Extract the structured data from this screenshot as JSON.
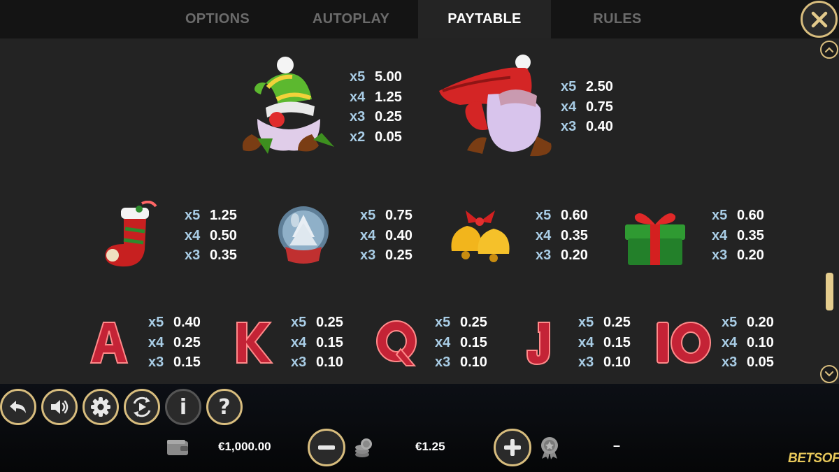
{
  "tabs": [
    {
      "label": "OPTIONS",
      "active": false
    },
    {
      "label": "AUTOPLAY",
      "active": false
    },
    {
      "label": "PAYTABLE",
      "active": true
    },
    {
      "label": "RULES",
      "active": false
    }
  ],
  "colors": {
    "accent_gold": "#d8bd7e",
    "multiplier_blue": "#a9cde6",
    "panel_bg": "#232323",
    "tab_bar_bg": "#141414"
  },
  "paytable": {
    "green_gnome": {
      "icon": "green-hat-gnome-icon",
      "pays": [
        {
          "mult": "x5",
          "value": "5.00"
        },
        {
          "mult": "x4",
          "value": "1.25"
        },
        {
          "mult": "x3",
          "value": "0.25"
        },
        {
          "mult": "x2",
          "value": "0.05"
        }
      ]
    },
    "red_gnome": {
      "icon": "red-hat-gnome-icon",
      "pays": [
        {
          "mult": "x5",
          "value": "2.50"
        },
        {
          "mult": "x4",
          "value": "0.75"
        },
        {
          "mult": "x3",
          "value": "0.40"
        }
      ]
    },
    "stocking": {
      "icon": "christmas-stocking-icon",
      "pays": [
        {
          "mult": "x5",
          "value": "1.25"
        },
        {
          "mult": "x4",
          "value": "0.50"
        },
        {
          "mult": "x3",
          "value": "0.35"
        }
      ]
    },
    "snow_globe": {
      "icon": "snow-globe-icon",
      "pays": [
        {
          "mult": "x5",
          "value": "0.75"
        },
        {
          "mult": "x4",
          "value": "0.40"
        },
        {
          "mult": "x3",
          "value": "0.25"
        }
      ]
    },
    "bells": {
      "icon": "bells-icon",
      "pays": [
        {
          "mult": "x5",
          "value": "0.60"
        },
        {
          "mult": "x4",
          "value": "0.35"
        },
        {
          "mult": "x3",
          "value": "0.20"
        }
      ]
    },
    "gift": {
      "icon": "gift-box-icon",
      "pays": [
        {
          "mult": "x5",
          "value": "0.60"
        },
        {
          "mult": "x4",
          "value": "0.35"
        },
        {
          "mult": "x3",
          "value": "0.20"
        }
      ]
    },
    "a": {
      "letter": "A",
      "pays": [
        {
          "mult": "x5",
          "value": "0.40"
        },
        {
          "mult": "x4",
          "value": "0.25"
        },
        {
          "mult": "x3",
          "value": "0.15"
        }
      ]
    },
    "k": {
      "letter": "K",
      "pays": [
        {
          "mult": "x5",
          "value": "0.25"
        },
        {
          "mult": "x4",
          "value": "0.15"
        },
        {
          "mult": "x3",
          "value": "0.10"
        }
      ]
    },
    "q": {
      "letter": "Q",
      "pays": [
        {
          "mult": "x5",
          "value": "0.25"
        },
        {
          "mult": "x4",
          "value": "0.15"
        },
        {
          "mult": "x3",
          "value": "0.10"
        }
      ]
    },
    "j": {
      "letter": "J",
      "pays": [
        {
          "mult": "x5",
          "value": "0.25"
        },
        {
          "mult": "x4",
          "value": "0.15"
        },
        {
          "mult": "x3",
          "value": "0.10"
        }
      ]
    },
    "ten": {
      "letter": "IO",
      "pays": [
        {
          "mult": "x5",
          "value": "0.20"
        },
        {
          "mult": "x4",
          "value": "0.10"
        },
        {
          "mult": "x3",
          "value": "0.05"
        }
      ]
    }
  },
  "controls": {
    "back": {
      "icon": "back-arrow-icon"
    },
    "sound": {
      "icon": "speaker-icon"
    },
    "settings": {
      "icon": "gear-icon"
    },
    "autoplay": {
      "icon": "autoplay-cycle-icon"
    },
    "info": {
      "icon": "info-icon",
      "label": "i"
    },
    "help": {
      "icon": "help-icon",
      "label": "?"
    }
  },
  "status_bar": {
    "balance": "€1,000.00",
    "balance_icon": "wallet-icon",
    "bet": "€1.25",
    "bet_icon": "coin-stack-icon",
    "win_icon": "award-badge-icon",
    "win": "–"
  },
  "brand_logo": "BETSOFT"
}
